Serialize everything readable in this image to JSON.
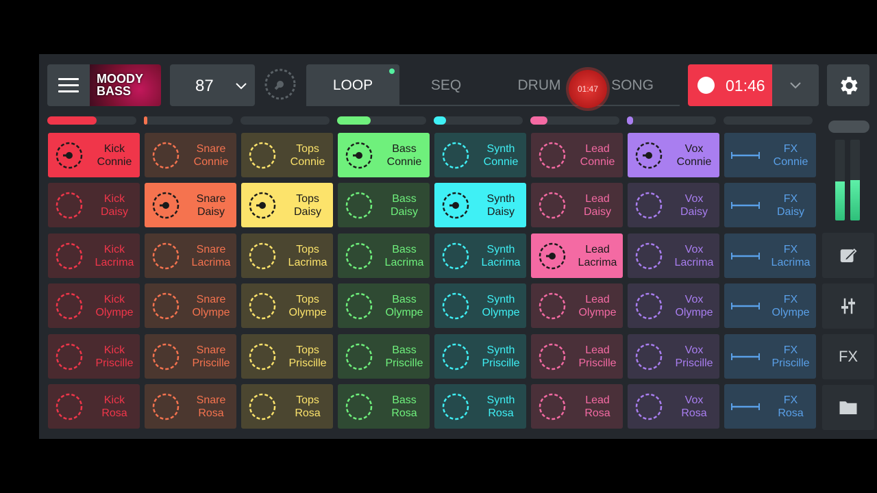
{
  "app": {
    "cover_title": "MOODY BASS"
  },
  "tempo": {
    "value": "87"
  },
  "modes": [
    {
      "label": "LOOP",
      "active": true
    },
    {
      "label": "SEQ",
      "active": false
    },
    {
      "label": "DRUM",
      "active": false
    },
    {
      "label": "SONG",
      "active": false
    }
  ],
  "floating_timer": "01:47",
  "record": {
    "time": "01:46"
  },
  "side": {
    "fx_label": "FX"
  },
  "colors": {
    "kick": "#f0364a",
    "snare": "#f5734f",
    "tops": "#fce36b",
    "bass": "#6ff07c",
    "synth": "#3ff0f5",
    "lead": "#f46aa3",
    "vox": "#a97ef0",
    "fx": "#5aa0e8"
  },
  "track_progress": [
    {
      "color": "#f0364a",
      "fill": 0.55
    },
    {
      "color": "#f5734f",
      "fill": 0.02
    },
    {
      "color": "#fce36b",
      "fill": 0.0
    },
    {
      "color": "#6ff07c",
      "fill": 0.38
    },
    {
      "color": "#3ff0f5",
      "fill": 0.14
    },
    {
      "color": "#f46aa3",
      "fill": 0.19
    },
    {
      "color": "#a97ef0",
      "fill": 0.07
    },
    {
      "color": "#5aa0e8",
      "fill": 0.0
    }
  ],
  "columns": [
    {
      "key": "kick",
      "name": "Kick",
      "dim_bg": "#4a2a2f",
      "lit_bg": "#f0364a",
      "text": "#f0364a",
      "ring": "#f0364a",
      "lit_text": "#1a1a1a"
    },
    {
      "key": "snare",
      "name": "Snare",
      "dim_bg": "#4b372f",
      "lit_bg": "#f5734f",
      "text": "#f5734f",
      "ring": "#f5734f",
      "lit_text": "#1a1a1a"
    },
    {
      "key": "tops",
      "name": "Tops",
      "dim_bg": "#4b4630",
      "lit_bg": "#fce36b",
      "text": "#fce36b",
      "ring": "#fce36b",
      "lit_text": "#1a1a1a"
    },
    {
      "key": "bass",
      "name": "Bass",
      "dim_bg": "#2f4a33",
      "lit_bg": "#6ff07c",
      "text": "#6ff07c",
      "ring": "#6ff07c",
      "lit_text": "#1a1a1a"
    },
    {
      "key": "synth",
      "name": "Synth",
      "dim_bg": "#254a4c",
      "lit_bg": "#3ff0f5",
      "text": "#3ff0f5",
      "ring": "#3ff0f5",
      "lit_text": "#1a1a1a"
    },
    {
      "key": "lead",
      "name": "Lead",
      "dim_bg": "#4a3039",
      "lit_bg": "#f46aa3",
      "text": "#f46aa3",
      "ring": "#f46aa3",
      "lit_text": "#1a1a1a"
    },
    {
      "key": "vox",
      "name": "Vox",
      "dim_bg": "#3a3548",
      "lit_bg": "#a97ef0",
      "text": "#a97ef0",
      "ring": "#a97ef0",
      "lit_text": "#1a1a1a"
    },
    {
      "key": "fx",
      "name": "FX",
      "dim_bg": "#2d4356",
      "lit_bg": "#5aa0e8",
      "text": "#5aa0e8",
      "ring": "#5aa0e8",
      "lit_text": "#1a1a1a"
    }
  ],
  "rows": [
    "Connie",
    "Daisy",
    "Lacrima",
    "Olympe",
    "Priscille",
    "Rosa"
  ],
  "active_pads": {
    "kick": 0,
    "snare": 1,
    "tops": 1,
    "bass": 0,
    "synth": 1,
    "lead": 2,
    "vox": 0
  },
  "meters": {
    "left": 0.48,
    "right": 0.5
  }
}
